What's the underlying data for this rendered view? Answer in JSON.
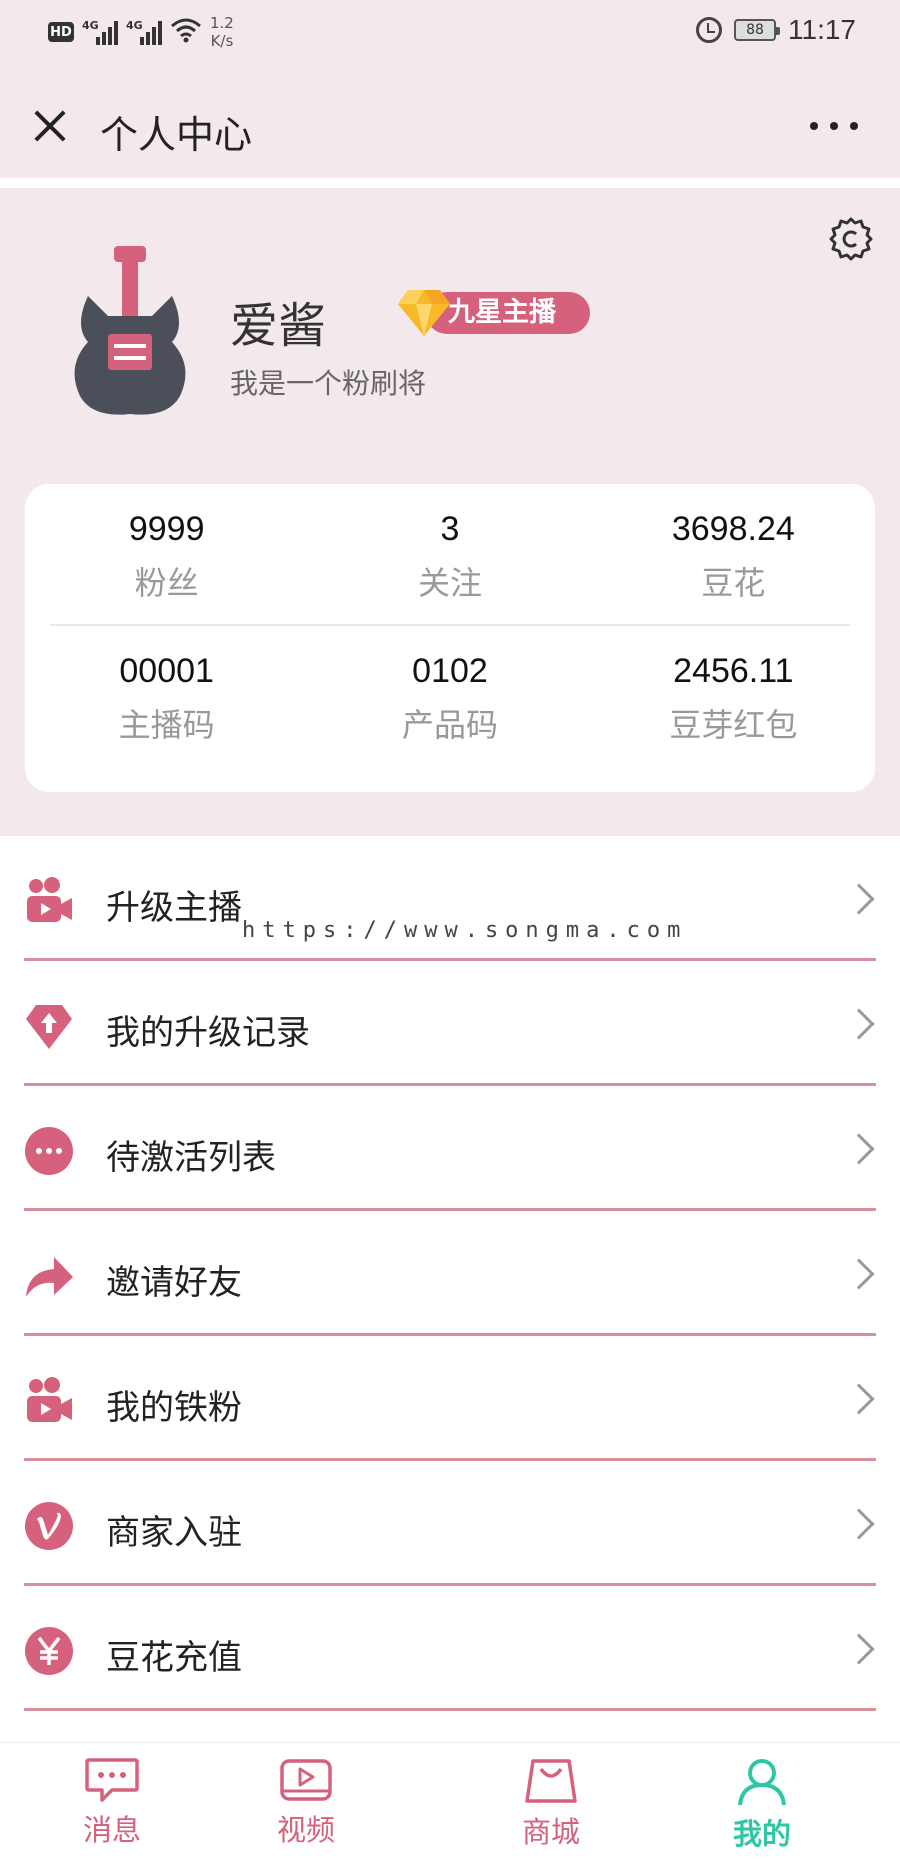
{
  "status_bar": {
    "network_badge": "HD",
    "sim1": "4G",
    "sim2": "4G",
    "speed_value": "1.2",
    "speed_unit": "K/s",
    "battery": "88",
    "time": "11:17"
  },
  "nav": {
    "title": "个人中心"
  },
  "profile": {
    "name": "爱酱",
    "badge": "九星主播",
    "bio": "我是一个粉刷将"
  },
  "stats": {
    "row1": [
      {
        "value": "9999",
        "label": "粉丝"
      },
      {
        "value": "3",
        "label": "关注"
      },
      {
        "value": "3698.24",
        "label": "豆花"
      }
    ],
    "row2": [
      {
        "value": "00001",
        "label": "主播码"
      },
      {
        "value": "0102",
        "label": "产品码"
      },
      {
        "value": "2456.11",
        "label": "豆芽红包"
      }
    ]
  },
  "menu": [
    {
      "label": "升级主播",
      "icon": "camera-people-icon"
    },
    {
      "label": "我的升级记录",
      "icon": "diamond-up-icon"
    },
    {
      "label": "待激活列表",
      "icon": "more-circle-icon"
    },
    {
      "label": "邀请好友",
      "icon": "share-arrow-icon"
    },
    {
      "label": "我的铁粉",
      "icon": "camera-people-icon"
    },
    {
      "label": "商家入驻",
      "icon": "vimeo-v-icon"
    },
    {
      "label": "豆花充值",
      "icon": "yen-icon"
    }
  ],
  "watermark": "https://www.songma.com",
  "tabs": [
    {
      "label": "消息",
      "icon": "message-icon"
    },
    {
      "label": "视频",
      "icon": "video-icon"
    },
    {
      "label": "商城",
      "icon": "shopping-bag-icon"
    },
    {
      "label": "我的",
      "icon": "person-icon",
      "active": true
    }
  ],
  "colors": {
    "accent_pink": "#d6617c",
    "background_pink": "#f3e9ec",
    "active_green": "#2ec7a5"
  }
}
